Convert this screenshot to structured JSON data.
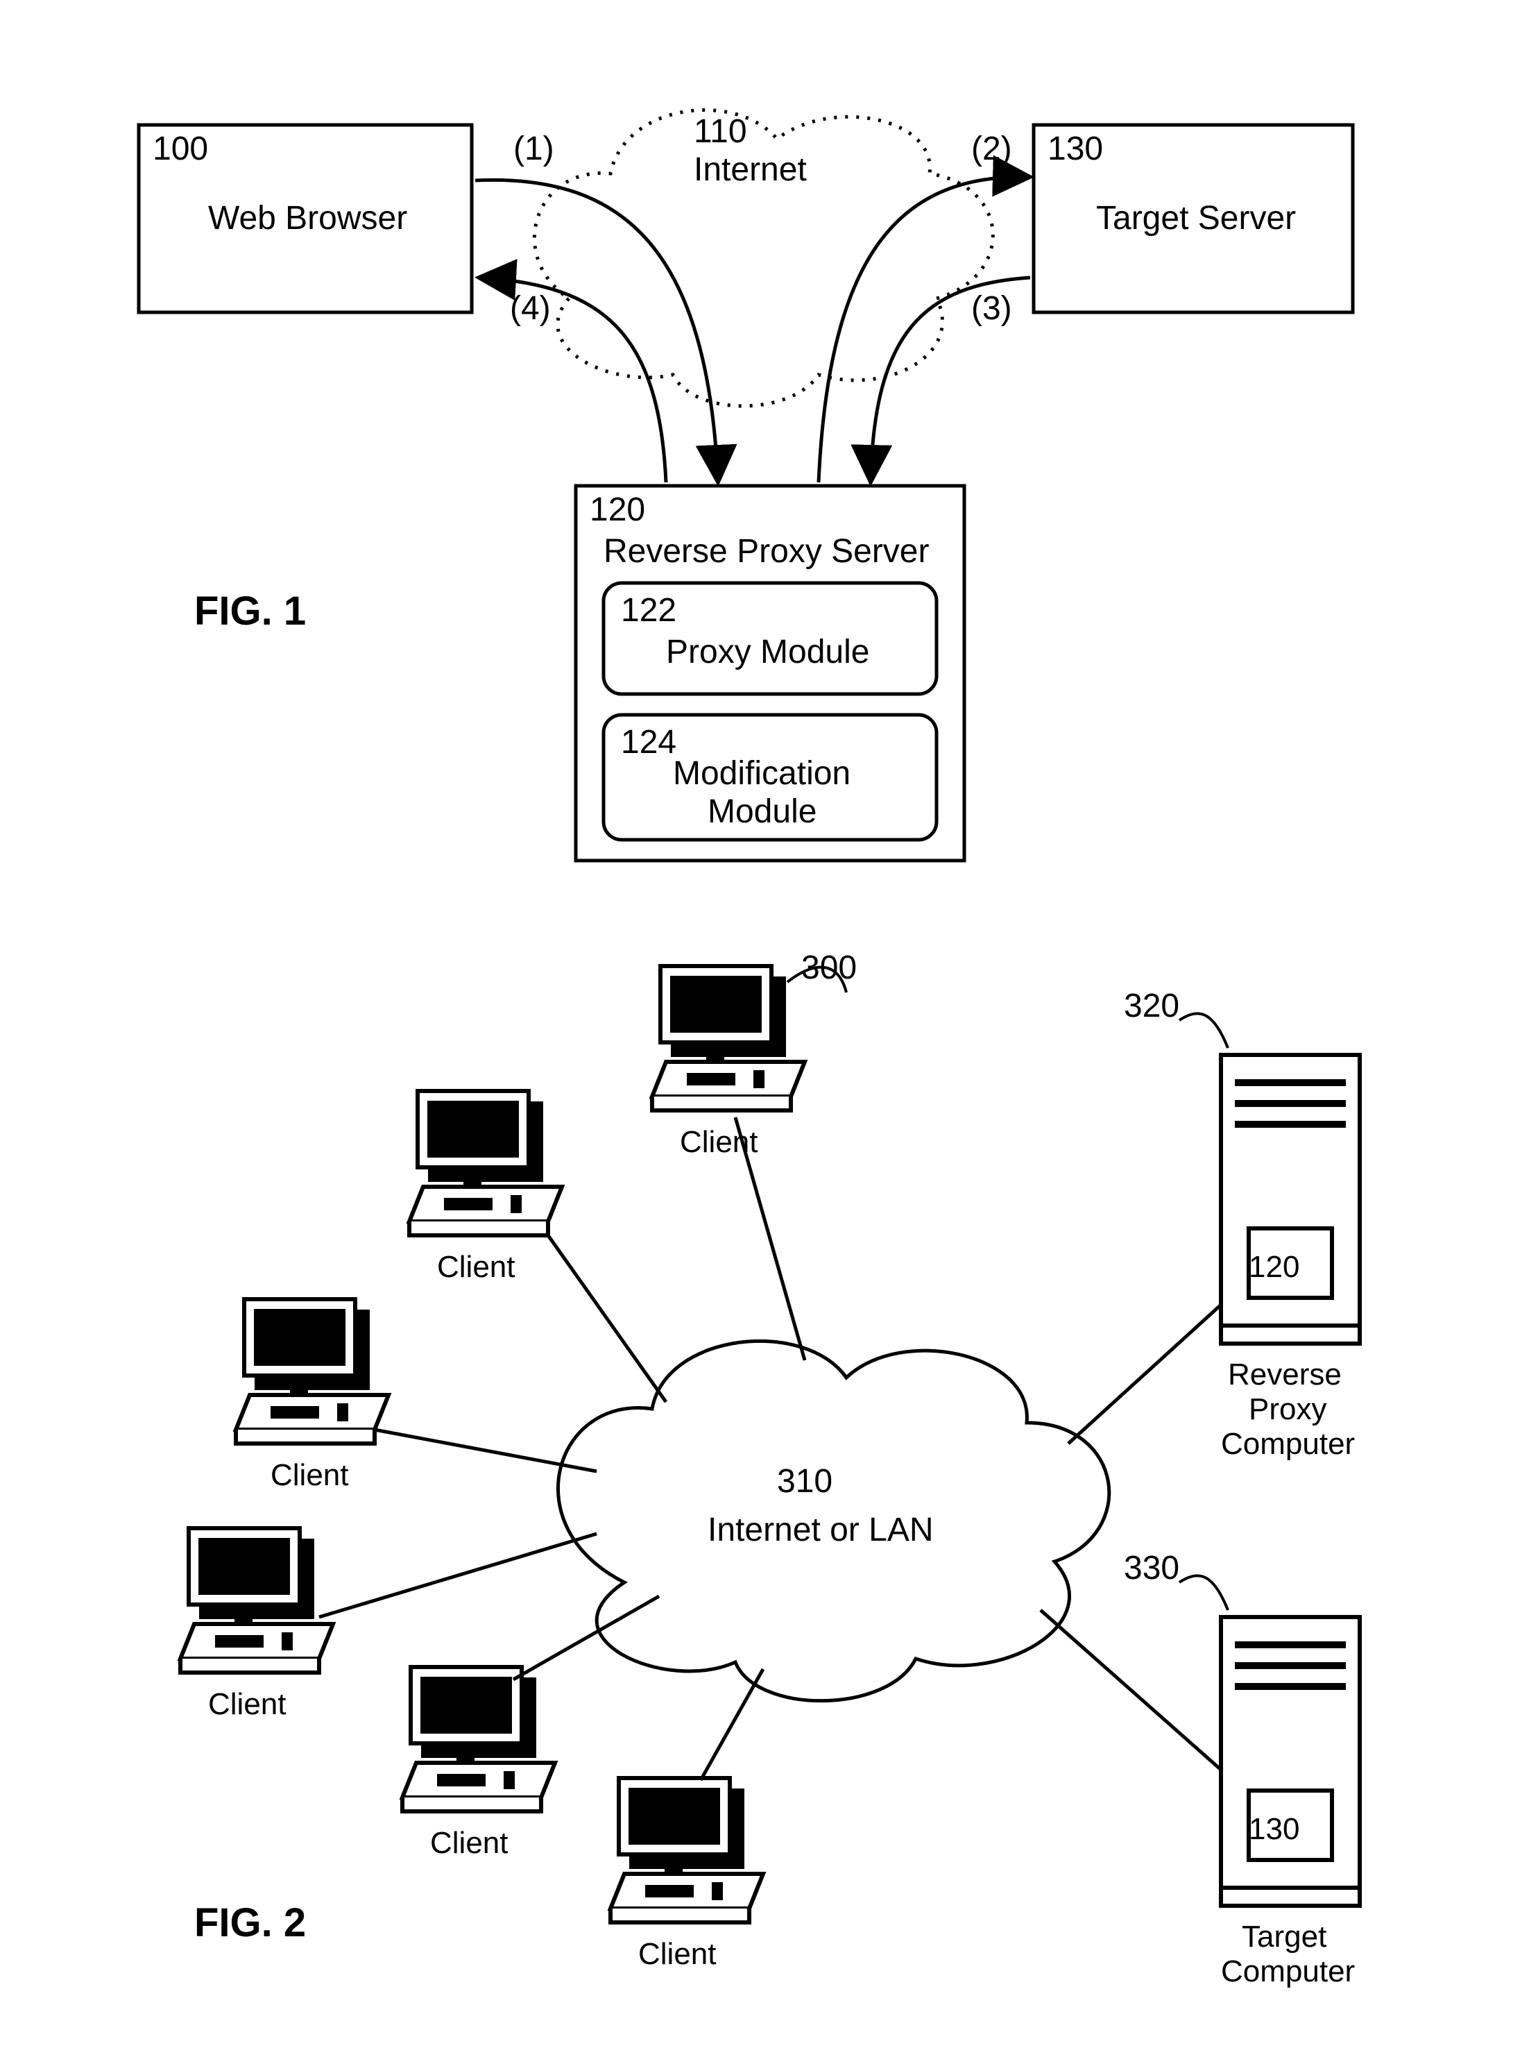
{
  "fig1": {
    "title": "FIG. 1",
    "webBrowser": {
      "ref": "100",
      "label": "Web Browser"
    },
    "internet": {
      "ref": "110",
      "label": "Internet"
    },
    "reverseProxy": {
      "ref": "120",
      "label": "Reverse Proxy Server"
    },
    "proxyModule": {
      "ref": "122",
      "label": "Proxy Module"
    },
    "modModule": {
      "ref": "124",
      "label1": "Modification",
      "label2": "Module"
    },
    "targetServer": {
      "ref": "130",
      "label": "Target Server"
    },
    "flows": {
      "f1": "(1)",
      "f2": "(2)",
      "f3": "(3)",
      "f4": "(4)"
    }
  },
  "fig2": {
    "title": "FIG. 2",
    "clientRef": "300",
    "clientLabel": "Client",
    "revProxyRef": "320",
    "revProxyLabel1": "Reverse",
    "revProxyLabel2": "Proxy",
    "revProxyLabel3": "Computer",
    "revProxyBadge": "120",
    "targetRef": "330",
    "targetLabel1": "Target",
    "targetLabel2": "Computer",
    "targetBadge": "130",
    "cloudRef": "310",
    "cloudLabel": "Internet or LAN"
  }
}
